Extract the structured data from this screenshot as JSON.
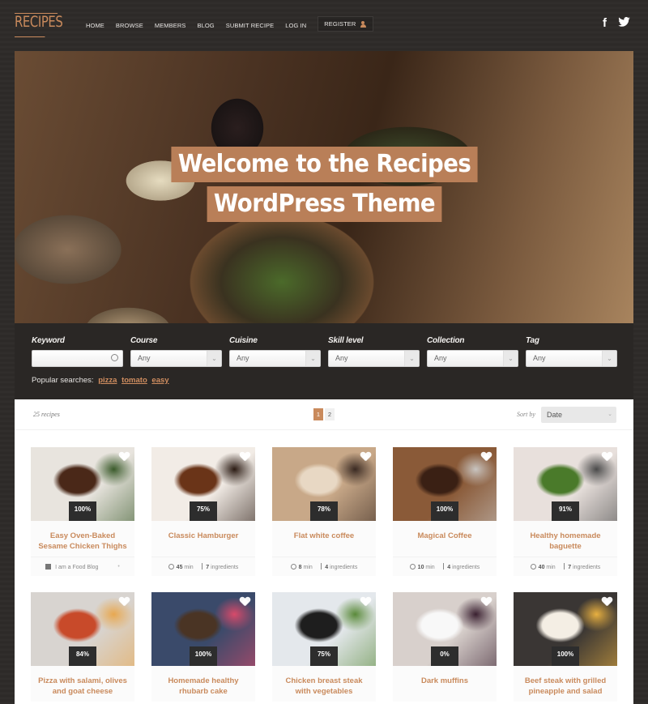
{
  "header": {
    "logo": "RECIPES",
    "nav": [
      "HOME",
      "BROWSE",
      "MEMBERS",
      "BLOG",
      "SUBMIT RECIPE",
      "LOG IN"
    ],
    "register": "REGISTER",
    "social": {
      "facebook": "f",
      "twitter": "🐦"
    }
  },
  "hero": {
    "line1": "Welcome to the Recipes",
    "line2": "WordPress Theme"
  },
  "search": {
    "keyword_label": "Keyword",
    "keyword_value": "",
    "filters": [
      {
        "label": "Course",
        "value": "Any"
      },
      {
        "label": "Cuisine",
        "value": "Any"
      },
      {
        "label": "Skill level",
        "value": "Any"
      },
      {
        "label": "Collection",
        "value": "Any"
      },
      {
        "label": "Tag",
        "value": "Any"
      }
    ],
    "popular_label": "Popular searches:",
    "popular": [
      "pizza",
      "tomato",
      "easy"
    ]
  },
  "results": {
    "count": "25 recipes",
    "pages": [
      "1",
      "2"
    ],
    "active_page": "1",
    "sort_label": "Sort by",
    "sort_value": "Date"
  },
  "recipes": [
    {
      "title": "Easy Oven-Baked Sesame Chicken Thighs",
      "rating": "100%",
      "source": "I am a Food Blog",
      "img": [
        "#e8e4de",
        "#4a2818",
        "#3a5a2a"
      ]
    },
    {
      "title": "Classic Hamburger",
      "rating": "75%",
      "time": "45",
      "time_unit": "min",
      "ingredients": "7",
      "ingredients_label": "ingredients",
      "img": [
        "#f2ece6",
        "#6a3418",
        "#2a1a12"
      ]
    },
    {
      "title": "Flat white coffee",
      "rating": "78%",
      "time": "8",
      "time_unit": "min",
      "ingredients": "4",
      "ingredients_label": "ingredients",
      "img": [
        "#c8a888",
        "#e8d8c4",
        "#3a2a22"
      ]
    },
    {
      "title": "Magical Coffee",
      "rating": "100%",
      "time": "10",
      "time_unit": "min",
      "ingredients": "4",
      "ingredients_label": "ingredients",
      "img": [
        "#8a5a38",
        "#3a2014",
        "#c8c4c0"
      ]
    },
    {
      "title": "Healthy homemade baguette",
      "rating": "91%",
      "time": "40",
      "time_unit": "min",
      "ingredients": "7",
      "ingredients_label": "ingredients",
      "img": [
        "#e8e0dc",
        "#4a7a2a",
        "#4a4a4a"
      ]
    },
    {
      "title": "Pizza with salami, olives and goat cheese",
      "rating": "84%",
      "img": [
        "#d8d4d0",
        "#c84a2a",
        "#e8a850"
      ]
    },
    {
      "title": "Homemade healthy rhubarb cake",
      "rating": "100%",
      "img": [
        "#3a4a6a",
        "#4a3424",
        "#d84a6a"
      ]
    },
    {
      "title": "Chicken breast steak with vegetables",
      "rating": "75%",
      "img": [
        "#e4e8ec",
        "#1e1e1e",
        "#5a8a3a"
      ]
    },
    {
      "title": "Dark muffins",
      "rating": "0%",
      "img": [
        "#d8d0cc",
        "#f8f8f8",
        "#3a2030"
      ]
    },
    {
      "title": "Beef steak with grilled pineapple and salad",
      "rating": "100%",
      "img": [
        "#3a3634",
        "#f4eee4",
        "#e8b040"
      ]
    }
  ]
}
